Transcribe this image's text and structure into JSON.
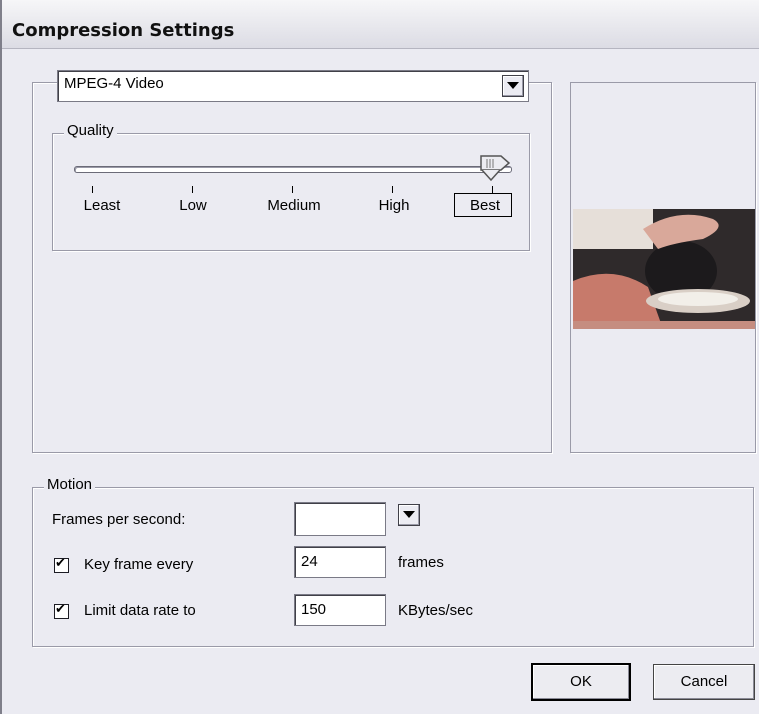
{
  "window": {
    "title": "Compression Settings"
  },
  "compressor": {
    "selected": "MPEG-4 Video"
  },
  "quality": {
    "label": "Quality",
    "levels": [
      "Least",
      "Low",
      "Medium",
      "High",
      "Best"
    ],
    "selected": "Best",
    "value_fraction": 1.0
  },
  "motion": {
    "label": "Motion",
    "fps_label": "Frames per second:",
    "fps_value": "",
    "keyframe_label": "Key frame every",
    "keyframe_checked": true,
    "keyframe_value": "24",
    "keyframe_unit": "frames",
    "datarate_label": "Limit data rate to",
    "datarate_checked": true,
    "datarate_value": "150",
    "datarate_unit": "KBytes/sec"
  },
  "buttons": {
    "ok": "OK",
    "cancel": "Cancel"
  },
  "colors": {
    "dialog_bg": "#ebebf2",
    "border": "#9a9aa8"
  }
}
